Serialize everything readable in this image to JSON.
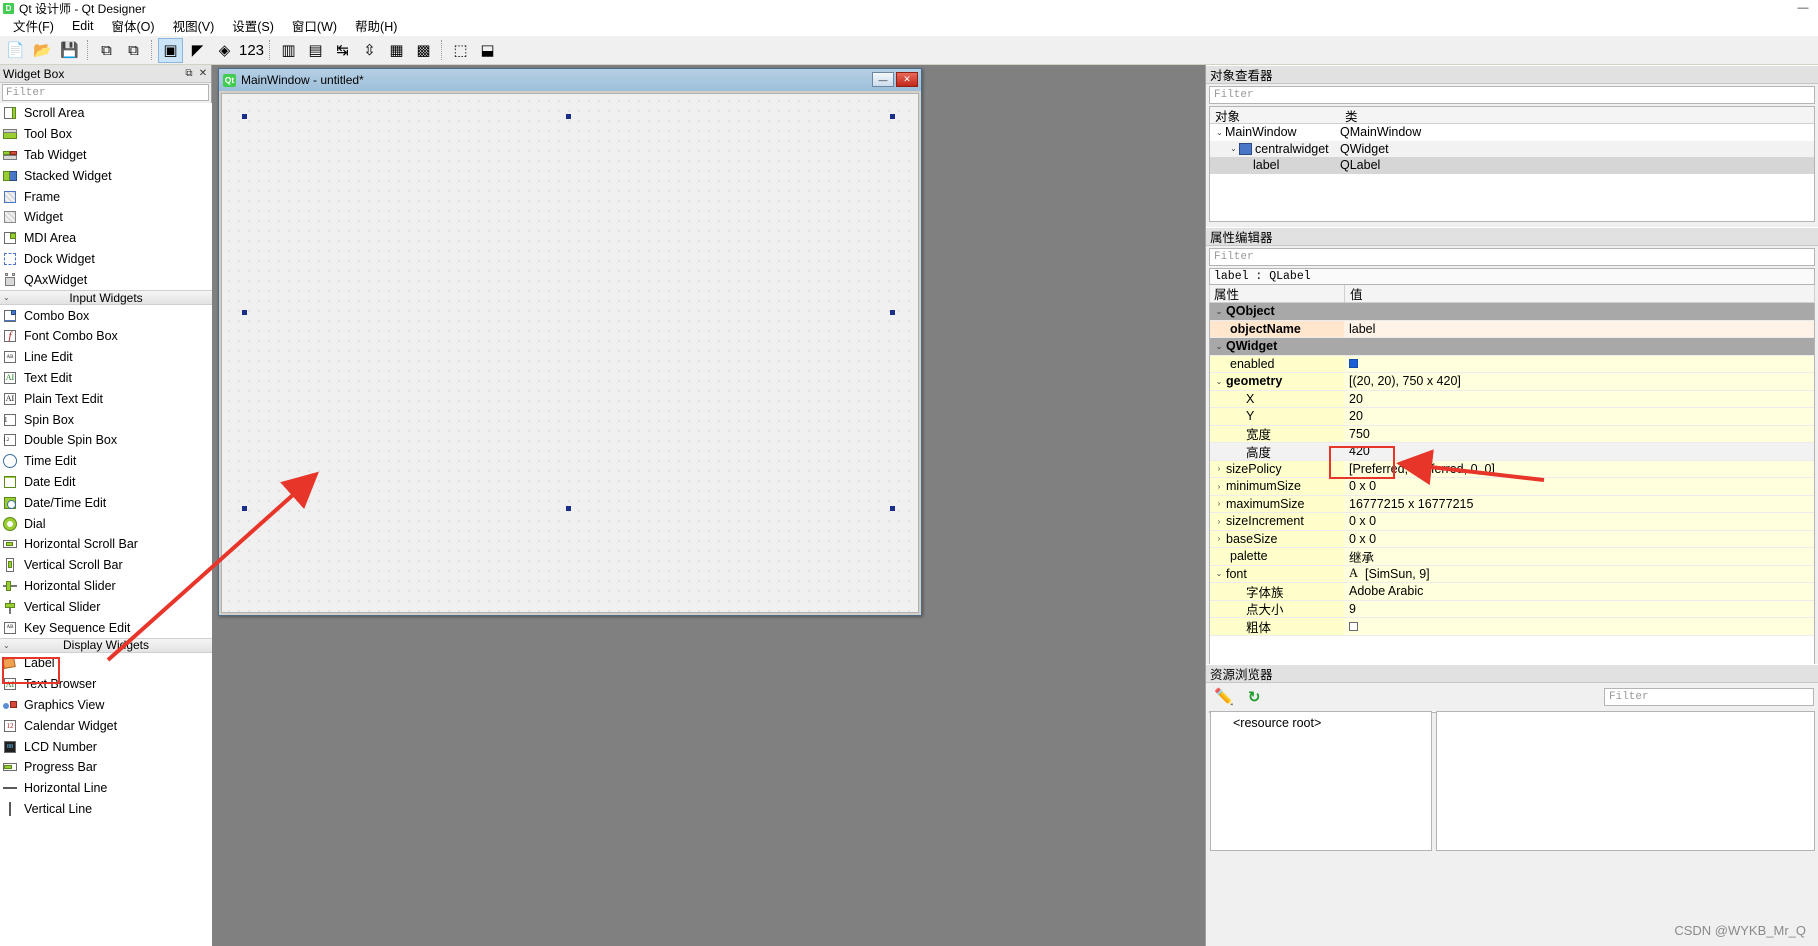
{
  "window": {
    "title": "Qt 设计师 - Qt Designer",
    "logo": "qt-logo",
    "minimize": "—",
    "maximize": "▢",
    "close": "✕"
  },
  "menu": {
    "items": [
      {
        "label": "文件(F)",
        "name": "menu-file"
      },
      {
        "label": "Edit",
        "name": "menu-edit"
      },
      {
        "label": "窗体(O)",
        "name": "menu-form"
      },
      {
        "label": "视图(V)",
        "name": "menu-view"
      },
      {
        "label": "设置(S)",
        "name": "menu-settings"
      },
      {
        "label": "窗口(W)",
        "name": "menu-window"
      },
      {
        "label": "帮助(H)",
        "name": "menu-help"
      }
    ]
  },
  "toolbar": {
    "buttons": [
      {
        "name": "new-file-icon",
        "glyph": "📄",
        "active": false
      },
      {
        "name": "open-file-icon",
        "glyph": "📂",
        "active": false
      },
      {
        "name": "save-file-icon",
        "glyph": "💾",
        "active": false
      },
      {
        "name": "separator",
        "glyph": "",
        "active": false
      },
      {
        "name": "undo-icon",
        "glyph": "⧉",
        "active": false
      },
      {
        "name": "redo-icon",
        "glyph": "⧉",
        "active": false
      },
      {
        "name": "separator",
        "glyph": "",
        "active": false
      },
      {
        "name": "edit-widgets-icon",
        "glyph": "▣",
        "active": true
      },
      {
        "name": "edit-signals-slots-icon",
        "glyph": "◤",
        "active": false
      },
      {
        "name": "edit-buddies-icon",
        "glyph": "◈",
        "active": false
      },
      {
        "name": "edit-tab-order-icon",
        "glyph": "123",
        "active": false
      },
      {
        "name": "separator",
        "glyph": "",
        "active": false
      },
      {
        "name": "layout-horizontally-icon",
        "glyph": "▥",
        "active": false
      },
      {
        "name": "layout-vertically-icon",
        "glyph": "▤",
        "active": false
      },
      {
        "name": "layout-splitter-h-icon",
        "glyph": "↹",
        "active": false
      },
      {
        "name": "layout-splitter-v-icon",
        "glyph": "⇳",
        "active": false
      },
      {
        "name": "layout-grid-icon",
        "glyph": "▦",
        "active": false
      },
      {
        "name": "layout-form-icon",
        "glyph": "▩",
        "active": false
      },
      {
        "name": "separator",
        "glyph": "",
        "active": false
      },
      {
        "name": "break-layout-icon",
        "glyph": "⬚",
        "active": false
      },
      {
        "name": "adjust-size-icon",
        "glyph": "⬓",
        "active": false
      }
    ]
  },
  "widget_box": {
    "title": "Widget Box",
    "float_icon": "⧉",
    "close_icon": "✕",
    "filter_placeholder": "Filter",
    "items": [
      {
        "label": "Scroll Area",
        "icon": "scroll-area-icon",
        "type": "item"
      },
      {
        "label": "Tool Box",
        "icon": "tool-box-icon",
        "type": "item"
      },
      {
        "label": "Tab Widget",
        "icon": "tab-widget-icon",
        "type": "item"
      },
      {
        "label": "Stacked Widget",
        "icon": "stacked-widget-icon",
        "type": "item"
      },
      {
        "label": "Frame",
        "icon": "frame-icon",
        "type": "item"
      },
      {
        "label": "Widget",
        "icon": "widget-icon",
        "type": "item"
      },
      {
        "label": "MDI Area",
        "icon": "mdi-area-icon",
        "type": "item"
      },
      {
        "label": "Dock Widget",
        "icon": "dock-widget-icon",
        "type": "item"
      },
      {
        "label": "QAxWidget",
        "icon": "qax-widget-icon",
        "type": "item"
      },
      {
        "label": "Input Widgets",
        "icon": "",
        "type": "group"
      },
      {
        "label": "Combo Box",
        "icon": "combo-box-icon",
        "type": "item"
      },
      {
        "label": "Font Combo Box",
        "icon": "font-combo-box-icon",
        "type": "item"
      },
      {
        "label": "Line Edit",
        "icon": "line-edit-icon",
        "type": "item"
      },
      {
        "label": "Text Edit",
        "icon": "text-edit-icon",
        "type": "item"
      },
      {
        "label": "Plain Text Edit",
        "icon": "plain-text-edit-icon",
        "type": "item"
      },
      {
        "label": "Spin Box",
        "icon": "spin-box-icon",
        "type": "item"
      },
      {
        "label": "Double Spin Box",
        "icon": "double-spin-box-icon",
        "type": "item"
      },
      {
        "label": "Time Edit",
        "icon": "time-edit-icon",
        "type": "item"
      },
      {
        "label": "Date Edit",
        "icon": "date-edit-icon",
        "type": "item"
      },
      {
        "label": "Date/Time Edit",
        "icon": "date-time-edit-icon",
        "type": "item"
      },
      {
        "label": "Dial",
        "icon": "dial-icon",
        "type": "item"
      },
      {
        "label": "Horizontal Scroll Bar",
        "icon": "horizontal-scroll-bar-icon",
        "type": "item"
      },
      {
        "label": "Vertical Scroll Bar",
        "icon": "vertical-scroll-bar-icon",
        "type": "item"
      },
      {
        "label": "Horizontal Slider",
        "icon": "horizontal-slider-icon",
        "type": "item"
      },
      {
        "label": "Vertical Slider",
        "icon": "vertical-slider-icon",
        "type": "item"
      },
      {
        "label": "Key Sequence Edit",
        "icon": "key-sequence-edit-icon",
        "type": "item"
      },
      {
        "label": "Display Widgets",
        "icon": "",
        "type": "group"
      },
      {
        "label": "Label",
        "icon": "label-icon",
        "type": "item",
        "highlighted": true
      },
      {
        "label": "Text Browser",
        "icon": "text-browser-icon",
        "type": "item"
      },
      {
        "label": "Graphics View",
        "icon": "graphics-view-icon",
        "type": "item"
      },
      {
        "label": "Calendar Widget",
        "icon": "calendar-widget-icon",
        "type": "item"
      },
      {
        "label": "LCD Number",
        "icon": "lcd-number-icon",
        "type": "item"
      },
      {
        "label": "Progress Bar",
        "icon": "progress-bar-icon",
        "type": "item"
      },
      {
        "label": "Horizontal Line",
        "icon": "horizontal-line-icon",
        "type": "item"
      },
      {
        "label": "Vertical Line",
        "icon": "vertical-line-icon",
        "type": "item"
      }
    ]
  },
  "form": {
    "title": "MainWindow - untitled*",
    "logo": "Qt",
    "minimize": "—",
    "close": "✕"
  },
  "object_inspector": {
    "title": "对象查看器",
    "filter_placeholder": "Filter",
    "col_object": "对象",
    "col_class": "类",
    "rows": [
      {
        "name": "MainWindow",
        "class": "QMainWindow",
        "depth": 0,
        "expander": "⌄",
        "selected": false
      },
      {
        "name": "centralwidget",
        "class": "QWidget",
        "depth": 1,
        "expander": "⌄",
        "selected": false,
        "icon": "central-widget-icon"
      },
      {
        "name": "label",
        "class": "QLabel",
        "depth": 2,
        "expander": "",
        "selected": true
      }
    ]
  },
  "property_editor": {
    "title": "属性编辑器",
    "filter_placeholder": "Filter",
    "target": "label : QLabel",
    "col_property": "属性",
    "col_value": "值",
    "rows": [
      {
        "name": "QObject",
        "value": "",
        "kind": "group",
        "expander": "⌄",
        "indent": 0
      },
      {
        "name": "objectName",
        "value": "label",
        "kind": "peach",
        "expander": "",
        "indent": 1,
        "bold": true
      },
      {
        "name": "QWidget",
        "value": "",
        "kind": "group",
        "expander": "⌄",
        "indent": 0
      },
      {
        "name": "enabled",
        "value": "",
        "kind": "yellow",
        "expander": "",
        "indent": 1,
        "checkbox": true
      },
      {
        "name": "geometry",
        "value": "[(20, 20), 750 x 420]",
        "kind": "yellow",
        "expander": "⌄",
        "indent": 0,
        "bold": true
      },
      {
        "name": "X",
        "value": "20",
        "kind": "yellow",
        "expander": "",
        "indent": 2
      },
      {
        "name": "Y",
        "value": "20",
        "kind": "yellow",
        "expander": "",
        "indent": 2
      },
      {
        "name": "宽度",
        "value": "750",
        "kind": "yellow",
        "expander": "",
        "indent": 2
      },
      {
        "name": "高度",
        "value": "420",
        "kind": "graybg",
        "expander": "",
        "indent": 2
      },
      {
        "name": "sizePolicy",
        "value": "[Preferred, Preferred, 0, 0]",
        "kind": "yellow",
        "expander": "›",
        "indent": 0
      },
      {
        "name": "minimumSize",
        "value": "0 x 0",
        "kind": "yellow",
        "expander": "›",
        "indent": 0
      },
      {
        "name": "maximumSize",
        "value": "16777215 x 16777215",
        "kind": "yellow",
        "expander": "›",
        "indent": 0
      },
      {
        "name": "sizeIncrement",
        "value": "0 x 0",
        "kind": "yellow",
        "expander": "›",
        "indent": 0
      },
      {
        "name": "baseSize",
        "value": "0 x 0",
        "kind": "yellow",
        "expander": "›",
        "indent": 0
      },
      {
        "name": "palette",
        "value": "继承",
        "kind": "yellow",
        "expander": "",
        "indent": 1
      },
      {
        "name": "font",
        "value": "[SimSun, 9]",
        "kind": "yellow",
        "expander": "⌄",
        "indent": 0,
        "fonticon": "A"
      },
      {
        "name": "字体族",
        "value": "Adobe Arabic",
        "kind": "yellow",
        "expander": "",
        "indent": 2
      },
      {
        "name": "点大小",
        "value": "9",
        "kind": "yellow",
        "expander": "",
        "indent": 2
      },
      {
        "name": "粗体",
        "value": "",
        "kind": "yellow",
        "expander": "",
        "indent": 2,
        "checkbox_off": true
      }
    ]
  },
  "resource_browser": {
    "title": "资源浏览器",
    "edit_icon": "pencil-icon",
    "reload_icon": "reload-icon",
    "filter_placeholder": "Filter",
    "root_label": "<resource root>"
  },
  "watermark": "CSDN @WYKB_Mr_Q",
  "colors": {
    "annotation_red": "#e8352a",
    "selection_handle": "#1b2f8a",
    "group_gray": "#a8a8a8",
    "prop_yellow": "#ffffcc",
    "prop_peach": "#ffe6cc",
    "canvas_gray": "#808080"
  }
}
